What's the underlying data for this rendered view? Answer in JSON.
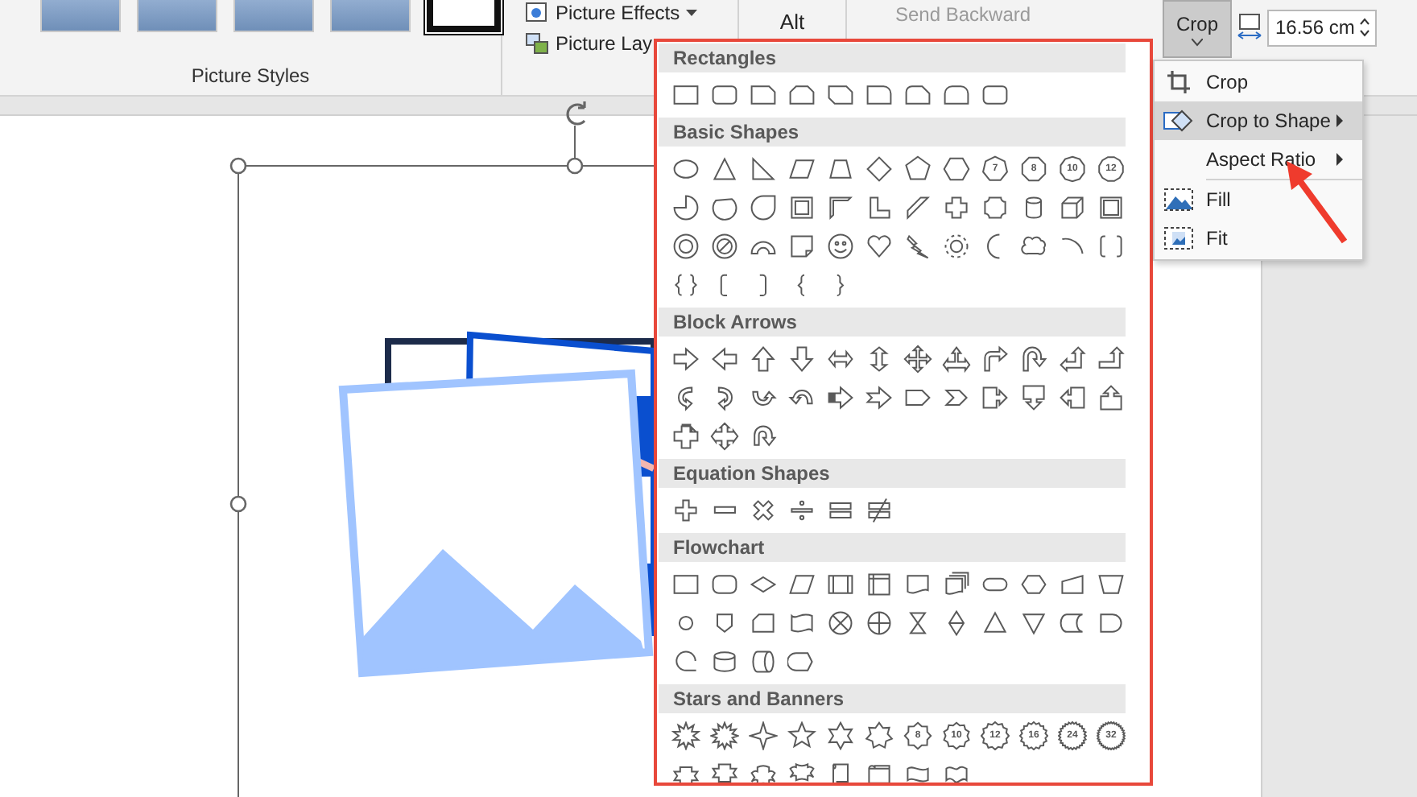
{
  "ribbon": {
    "picture_styles": {
      "label": "Picture Styles"
    },
    "picture_effects": "Picture Effects",
    "picture_layout": "Picture Lay",
    "alt_text": "Alt",
    "send_backward": {
      "label": "Send Backward",
      "disabled": true
    },
    "crop_button": {
      "label": "Crop",
      "pressed": true
    },
    "width_field": {
      "value": "16.56 cm"
    }
  },
  "shape_gallery": {
    "sections": [
      {
        "title": "Rectangles"
      },
      {
        "title": "Basic Shapes",
        "numbers": [
          "7",
          "8",
          "10",
          "12"
        ]
      },
      {
        "title": "Block Arrows"
      },
      {
        "title": "Equation Shapes"
      },
      {
        "title": "Flowchart"
      },
      {
        "title": "Stars and Banners",
        "numbers": [
          "8",
          "10",
          "12",
          "16",
          "24",
          "32"
        ]
      }
    ]
  },
  "crop_menu": {
    "groups": [
      [
        {
          "label": "Crop",
          "selected": false,
          "submenu": false
        },
        {
          "label": "Crop to Shape",
          "selected": true,
          "submenu": true
        },
        {
          "label": "Aspect Ratio",
          "selected": false,
          "submenu": true
        }
      ],
      [
        {
          "label": "Fill",
          "selected": false,
          "submenu": false
        },
        {
          "label": "Fit",
          "selected": false,
          "submenu": false
        }
      ]
    ]
  }
}
